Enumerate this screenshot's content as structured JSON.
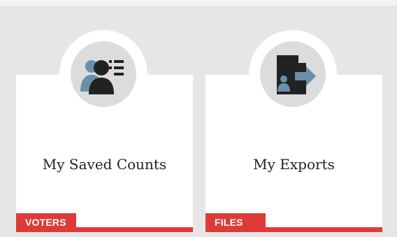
{
  "cards": [
    {
      "title": "My Saved Counts",
      "tag": "VOTERS",
      "icon": "saved-counts-people-list-icon"
    },
    {
      "title": "My Exports",
      "tag": "FILES",
      "icon": "export-file-arrow-icon"
    }
  ],
  "colors": {
    "accent": "#de3b37",
    "card_bg": "#ffffff",
    "page_bg": "#e6e6e6",
    "icon_dark": "#222222",
    "icon_blue": "#6b8fa8",
    "icon_circle": "#dcdcdc"
  }
}
